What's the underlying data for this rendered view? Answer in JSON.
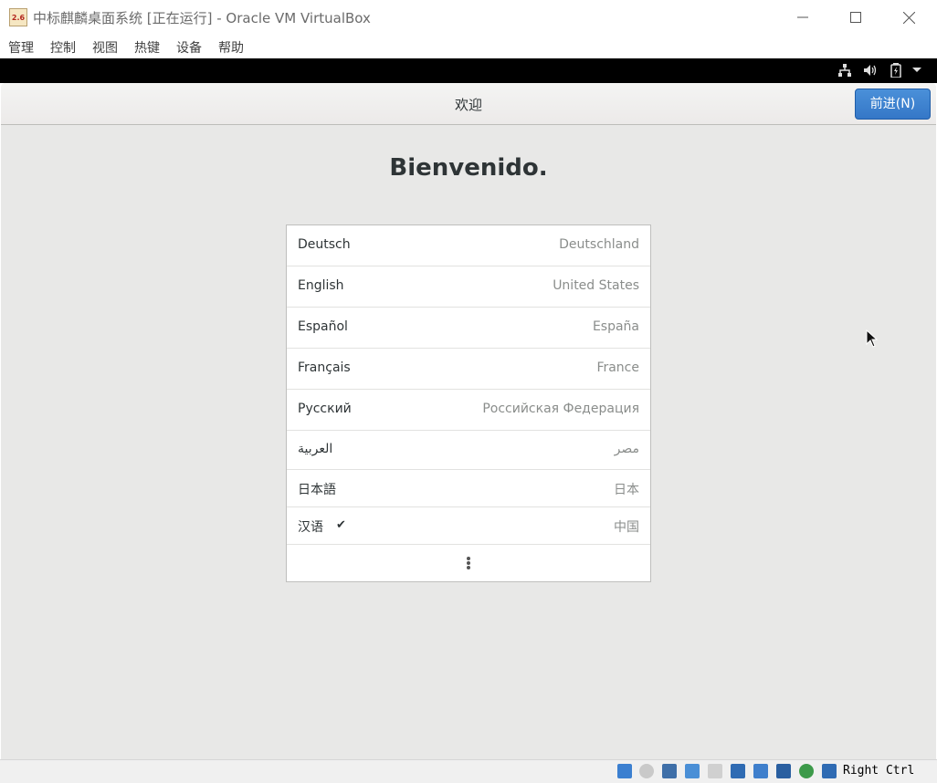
{
  "window": {
    "title": "中标麒麟桌面系统 [正在运行] - Oracle VM VirtualBox",
    "app_icon_text": "2.6"
  },
  "menu": [
    "管理",
    "控制",
    "视图",
    "热键",
    "设备",
    "帮助"
  ],
  "guest": {
    "header_title": "欢迎",
    "next_button": "前进(N)",
    "heading": "Bienvenido.",
    "languages": [
      {
        "name": "Deutsch",
        "region": "Deutschland",
        "selected": false
      },
      {
        "name": "English",
        "region": "United States",
        "selected": false
      },
      {
        "name": "Español",
        "region": "España",
        "selected": false
      },
      {
        "name": "Français",
        "region": "France",
        "selected": false
      },
      {
        "name": "Русский",
        "region": "Российская Федерация",
        "selected": false
      },
      {
        "name": "العربية",
        "region": "مصر",
        "selected": false
      },
      {
        "name": "日本語",
        "region": "日本",
        "selected": false
      },
      {
        "name": "汉语",
        "region": "中国",
        "selected": true
      }
    ],
    "more_icon": "more-vertical-icon",
    "check_glyph": "✔"
  },
  "statusbar": {
    "host_key": "Right Ctrl"
  },
  "colors": {
    "accent": "#3b82d0",
    "guest_bg": "#e8e8e7",
    "vm_panel": "#000000"
  }
}
